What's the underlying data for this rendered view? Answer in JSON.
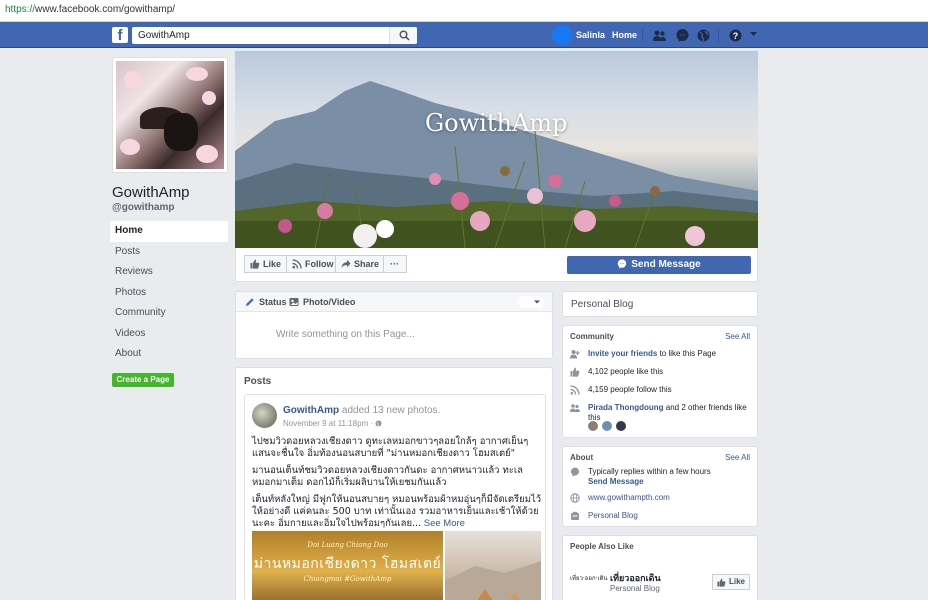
{
  "browser": {
    "url_scheme": "https://",
    "url_rest": "www.facebook.com/gowithamp/"
  },
  "nav": {
    "logo": "f",
    "search_value": "GowithAmp",
    "user_name": "Salinla",
    "home": "Home"
  },
  "page": {
    "name": "GowithAmp",
    "handle": "@gowithamp",
    "cover_title": "GowithAmp"
  },
  "left_nav": {
    "items": [
      "Home",
      "Posts",
      "Reviews",
      "Photos",
      "Community",
      "Videos",
      "About"
    ],
    "create_page": "Create a Page"
  },
  "actions": {
    "like": "Like",
    "follow": "Follow",
    "share": "Share",
    "more": "···",
    "send_message": "Send Message"
  },
  "composer": {
    "tab_status": "Status",
    "tab_photo": "Photo/Video",
    "placeholder": "Write something on this Page..."
  },
  "posts": {
    "title": "Posts",
    "post1": {
      "author": "GowithAmp",
      "action": "added 13 new photos.",
      "time": "November 9 at 11:18pm · ",
      "para1": "ไปชมวิวดอยหลวงเชียงดาว ดูทะเลหมอกขาวๆลอยใกล้ๆ อากาศเย็นๆแสนจะชื่นใจ อิ่มท้องนอนสบายที่ \"ม่านหมอกเชียงดาว โฮมสเตย์\"",
      "para2": "มานอนเต็นท์ชมวิวดอยหลวงเชียงดาวกันดะ อากาศหนาวแล้ว ทะเลหมอกมาเต็ม ดอกไม้ก็เริ่มผลิบานให้เยชมกันแล้ว",
      "para3": "เต็นท์หลังใหญ่ มีฟูกให้นอนสบายๆ หมอนพร้อมผ้าหมอุ่นๆก็มีจัดเตรียมไว้ให้อย่างดี แค่คนละ 500 บาท เท่านั้นเอง รวมอาหารเย็นและเช้าให้ด้วยนะคะ อิ่มกายและอิ่มใจไปพร้อมๆกันเลย...",
      "see_more": " See More",
      "image_text_top": "Doi Luang Chiang Dao",
      "image_text_main": "ม่านหมอกเชียงดาว โฮมสเตย์",
      "image_text_bottom": "Chiangmai #GowithAmp"
    }
  },
  "right": {
    "personal_blog": "Personal Blog",
    "community": {
      "title": "Community",
      "see_all": "See All",
      "invite_link": "Invite your friends",
      "invite_rest": " to like this Page",
      "likes": "4,102 people like this",
      "follows": "4,159 people follow this",
      "friend_name": "Pirada Thongdoung",
      "friend_rest": " and 2 other friends like this"
    },
    "about": {
      "title": "About",
      "see_all": "See All",
      "reply": "Typically replies within a few hours",
      "send_message": "Send Message",
      "website": "www.gowithampth.com",
      "category": "Personal Blog"
    },
    "people_also_like": {
      "title": "People Also Like",
      "logo_text": "เที่ยว·ออก·เดิน",
      "name": "เที่ยวออกเดิน",
      "category": "Personal Blog",
      "like": "Like"
    }
  },
  "colors": {
    "fb_blue": "#4267b2",
    "link": "#365899",
    "green": "#42b72a"
  }
}
